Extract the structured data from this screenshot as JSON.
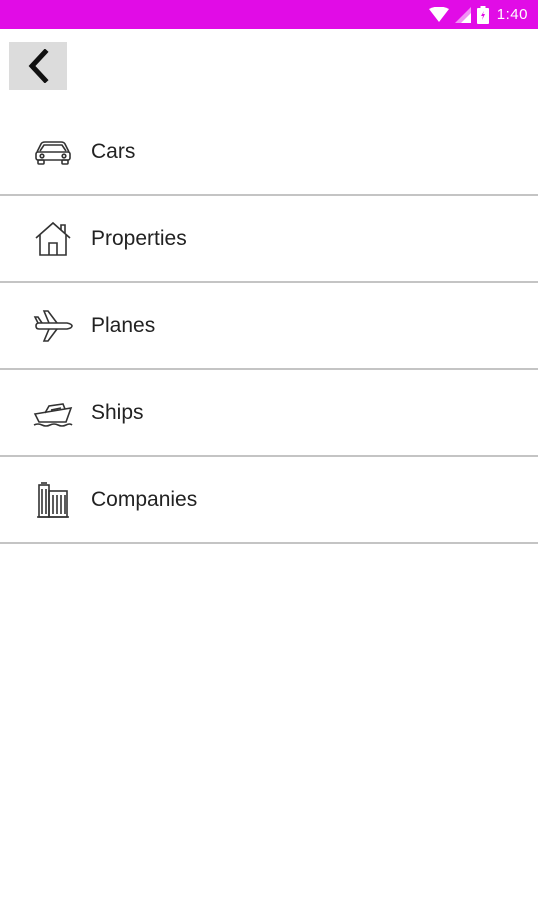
{
  "status_bar": {
    "time": "1:40",
    "background": "#e10ce6",
    "icons": [
      "wifi-icon",
      "cell-signal-icon",
      "battery-icon"
    ]
  },
  "app_bar": {
    "back_icon": "chevron-left-icon"
  },
  "menu": {
    "items": [
      {
        "label": "Cars",
        "icon": "car-icon"
      },
      {
        "label": "Properties",
        "icon": "house-icon"
      },
      {
        "label": "Planes",
        "icon": "airplane-icon"
      },
      {
        "label": "Ships",
        "icon": "ship-icon"
      },
      {
        "label": "Companies",
        "icon": "building-icon"
      }
    ]
  }
}
